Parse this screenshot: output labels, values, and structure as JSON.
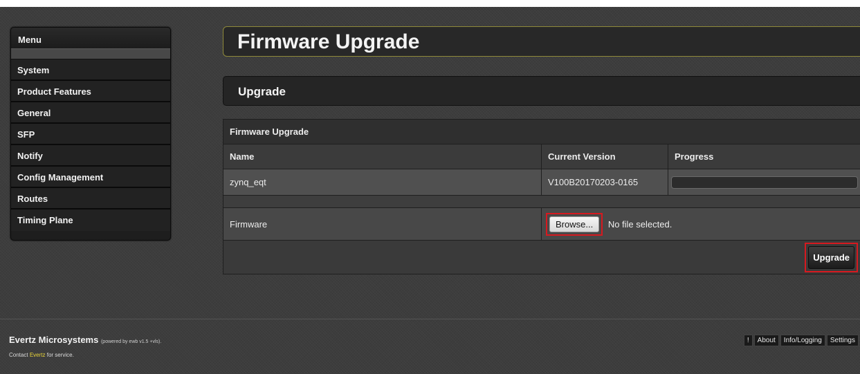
{
  "sidebar": {
    "title": "Menu",
    "items": [
      {
        "label": "System"
      },
      {
        "label": "Product Features"
      },
      {
        "label": "General"
      },
      {
        "label": "SFP"
      },
      {
        "label": "Notify"
      },
      {
        "label": "Config Management"
      },
      {
        "label": "Routes"
      },
      {
        "label": "Timing Plane"
      }
    ]
  },
  "page": {
    "title": "Firmware Upgrade",
    "section": "Upgrade"
  },
  "table": {
    "caption": "Firmware Upgrade",
    "columns": [
      "Name",
      "Current Version",
      "Progress"
    ],
    "rows": [
      {
        "name": "zynq_eqt",
        "version": "V100B20170203-0165",
        "progress": 0
      }
    ],
    "firmware_label": "Firmware",
    "browse_label": "Browse...",
    "file_status": "No file selected.",
    "upgrade_label": "Upgrade"
  },
  "footer": {
    "brand": "Evertz Microsystems",
    "powered": "(powered by ewb v1.5 +vls).",
    "contact_prefix": "Contact",
    "contact_link": "Evertz",
    "contact_suffix": "for service.",
    "links": [
      "!",
      "About",
      "Info/Logging",
      "Settings"
    ]
  }
}
